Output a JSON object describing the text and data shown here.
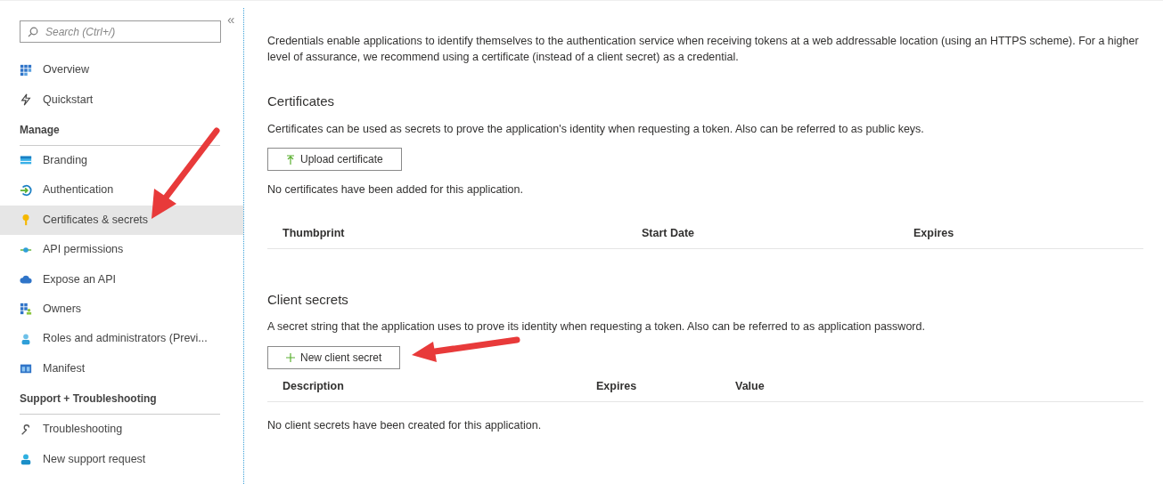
{
  "sidebar": {
    "search_placeholder": "Search (Ctrl+/)",
    "collapse": "«",
    "groups": [
      {
        "items": [
          {
            "label": "Overview",
            "selected": false
          },
          {
            "label": "Quickstart",
            "selected": false
          }
        ]
      },
      {
        "heading": "Manage",
        "items": [
          {
            "label": "Branding",
            "selected": false
          },
          {
            "label": "Authentication",
            "selected": false
          },
          {
            "label": "Certificates & secrets",
            "selected": true
          },
          {
            "label": "API permissions",
            "selected": false
          },
          {
            "label": "Expose an API",
            "selected": false
          },
          {
            "label": "Owners",
            "selected": false
          },
          {
            "label": "Roles and administrators (Previ...",
            "selected": false
          },
          {
            "label": "Manifest",
            "selected": false
          }
        ]
      },
      {
        "heading": "Support + Troubleshooting",
        "items": [
          {
            "label": "Troubleshooting",
            "selected": false
          },
          {
            "label": "New support request",
            "selected": false
          }
        ]
      }
    ]
  },
  "intro": "Credentials enable applications to identify themselves to the authentication service when receiving tokens at a web addressable location (using an HTTPS scheme). For a higher level of assurance, we recommend using a certificate (instead of a client secret) as a credential.",
  "sections": [
    {
      "kind": "upload",
      "heading": "Certificates",
      "description": "Certificates can be used as secrets to prove the application's identity when requesting a token. Also can be referred to as public keys.",
      "button": "Upload certificate",
      "columns": [
        "Thumbprint",
        "Start Date",
        "Expires"
      ],
      "empty_text": "No certificates have been added for this application."
    },
    {
      "kind": "add",
      "heading": "Client secrets",
      "description": "A secret string that the application uses to prove its identity when requesting a token. Also can be referred to as application password.",
      "button": "New client secret",
      "columns": [
        "Description",
        "Expires",
        "Value"
      ],
      "empty_text": "No client secrets have been created for this application."
    }
  ]
}
